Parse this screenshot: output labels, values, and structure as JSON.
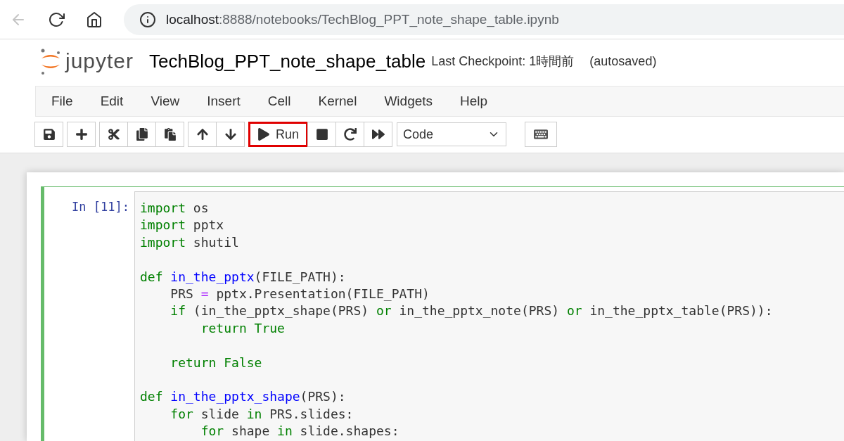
{
  "browser": {
    "url_host": "localhost",
    "url_rest": ":8888/notebooks/TechBlog_PPT_note_shape_table.ipynb"
  },
  "header": {
    "logo_text": "jupyter",
    "notebook_name": "TechBlog_PPT_note_shape_table",
    "checkpoint": "Last Checkpoint: 1時間前",
    "autosave": "(autosaved)"
  },
  "menu": [
    "File",
    "Edit",
    "View",
    "Insert",
    "Cell",
    "Kernel",
    "Widgets",
    "Help"
  ],
  "toolbar": {
    "groups": [
      [
        {
          "kind": "save"
        }
      ],
      [
        {
          "kind": "plus"
        }
      ],
      [
        {
          "kind": "cut"
        },
        {
          "kind": "copy"
        },
        {
          "kind": "paste"
        }
      ],
      [
        {
          "kind": "up"
        },
        {
          "kind": "down"
        }
      ],
      [
        {
          "kind": "run",
          "label": "Run",
          "highlighted": true
        },
        {
          "kind": "stop",
          "highlighted": false
        },
        {
          "kind": "restart",
          "highlighted": false
        },
        {
          "kind": "fastforward",
          "highlighted": false
        }
      ]
    ],
    "cell_type": "Code"
  },
  "cell": {
    "prompt": "In [11]:",
    "selected": true,
    "lines": [
      {
        "kind": "code",
        "tokens": [
          {
            "kind": "keyword",
            "t": "import "
          },
          {
            "kind": "plain",
            "t": "os"
          }
        ]
      },
      {
        "kind": "code",
        "tokens": [
          {
            "kind": "keyword",
            "t": "import "
          },
          {
            "kind": "plain",
            "t": "pptx"
          }
        ]
      },
      {
        "kind": "code",
        "tokens": [
          {
            "kind": "keyword",
            "t": "import "
          },
          {
            "kind": "plain",
            "t": "shutil"
          }
        ]
      },
      {
        "kind": "blank"
      },
      {
        "kind": "code",
        "tokens": [
          {
            "kind": "keyword",
            "t": "def "
          },
          {
            "kind": "function",
            "t": "in_the_pptx"
          },
          {
            "kind": "plain",
            "t": "(FILE_PATH):"
          }
        ]
      },
      {
        "kind": "code",
        "tokens": [
          {
            "kind": "plain",
            "t": "    PRS "
          },
          {
            "kind": "operator",
            "t": "="
          },
          {
            "kind": "plain",
            "t": " pptx.Presentation(FILE_PATH)"
          }
        ]
      },
      {
        "kind": "code",
        "tokens": [
          {
            "kind": "keyword",
            "t": "    if"
          },
          {
            "kind": "plain",
            "t": " (in_the_pptx_shape(PRS) "
          },
          {
            "kind": "keyword",
            "t": "or"
          },
          {
            "kind": "plain",
            "t": " in_the_pptx_note(PRS) "
          },
          {
            "kind": "keyword",
            "t": "or"
          },
          {
            "kind": "plain",
            "t": " in_the_pptx_table(PRS)):"
          }
        ]
      },
      {
        "kind": "code",
        "tokens": [
          {
            "kind": "keyword",
            "t": "        return True"
          }
        ]
      },
      {
        "kind": "blank"
      },
      {
        "kind": "code",
        "tokens": [
          {
            "kind": "keyword",
            "t": "    return False"
          }
        ]
      },
      {
        "kind": "blank"
      },
      {
        "kind": "code",
        "tokens": [
          {
            "kind": "keyword",
            "t": "def "
          },
          {
            "kind": "function",
            "t": "in_the_pptx_shape"
          },
          {
            "kind": "plain",
            "t": "(PRS):"
          }
        ]
      },
      {
        "kind": "code",
        "tokens": [
          {
            "kind": "keyword",
            "t": "    for"
          },
          {
            "kind": "plain",
            "t": " slide "
          },
          {
            "kind": "keyword",
            "t": "in"
          },
          {
            "kind": "plain",
            "t": " PRS.slides:"
          }
        ]
      },
      {
        "kind": "code",
        "tokens": [
          {
            "kind": "keyword",
            "t": "        for"
          },
          {
            "kind": "plain",
            "t": " shape "
          },
          {
            "kind": "keyword",
            "t": "in"
          },
          {
            "kind": "plain",
            "t": " slide.shapes:"
          }
        ]
      }
    ]
  }
}
